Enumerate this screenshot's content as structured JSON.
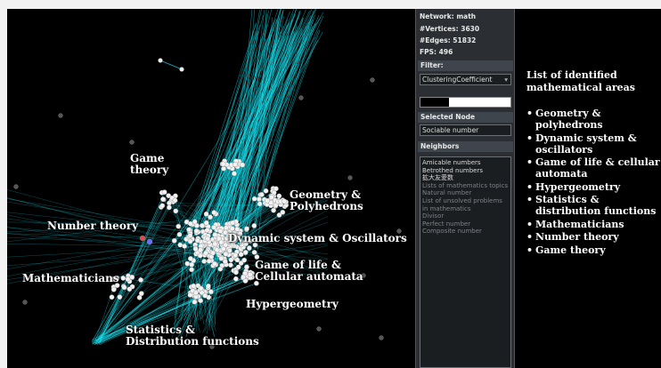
{
  "panel": {
    "network": "Network: math",
    "vertices": "#Vertices: 3630",
    "edges": "#Edges: 51832",
    "fps": "FPS: 496",
    "filter_label": "Filter:",
    "filter_value": "ClusteringCoefficient",
    "filter_slider_fraction": 0.68,
    "selected_node_label": "Selected Node",
    "selected_node_value": "Sociable number",
    "neighbors_label": "Neighbors",
    "neighbors": [
      {
        "text": "Amicable numbers",
        "state": "active"
      },
      {
        "text": "Betrothed numbers",
        "state": "active"
      },
      {
        "text": "拡大友愛数",
        "state": "active"
      },
      {
        "text": "Lists of mathematics topics",
        "state": "inactive"
      },
      {
        "text": "Natural number",
        "state": "inactive"
      },
      {
        "text": "List of unsolved problems in mathematics",
        "state": "inactive"
      },
      {
        "text": "Divisor",
        "state": "inactive"
      },
      {
        "text": "Perfect number",
        "state": "inactive"
      },
      {
        "text": "Composite number",
        "state": "inactive"
      }
    ]
  },
  "graph": {
    "labels": {
      "game_theory": "Game\ntheory",
      "number_theory": "Number theory",
      "mathematicians": "Mathematicians",
      "geometry": "Geometry &\nPolyhedrons",
      "dynamic": "Dynamic system & Oscillators",
      "game_of_life": "Game of life &\nCellular automata",
      "hypergeometry": "Hypergeometry",
      "statistics": "Statistics &\nDistribution functions"
    },
    "edge_color": "#19e3f2",
    "node_color": "#f2f2f2",
    "background": "#000000"
  },
  "notes": {
    "title": "List of identified mathematical areas",
    "items": [
      "Geometry & polyhedrons",
      "Dynamic system & oscillators",
      "Game of life & cellular automata",
      "Hypergeometry",
      "Statistics & distribution functions",
      "Mathematicians",
      "Number theory",
      "Game theory"
    ]
  }
}
